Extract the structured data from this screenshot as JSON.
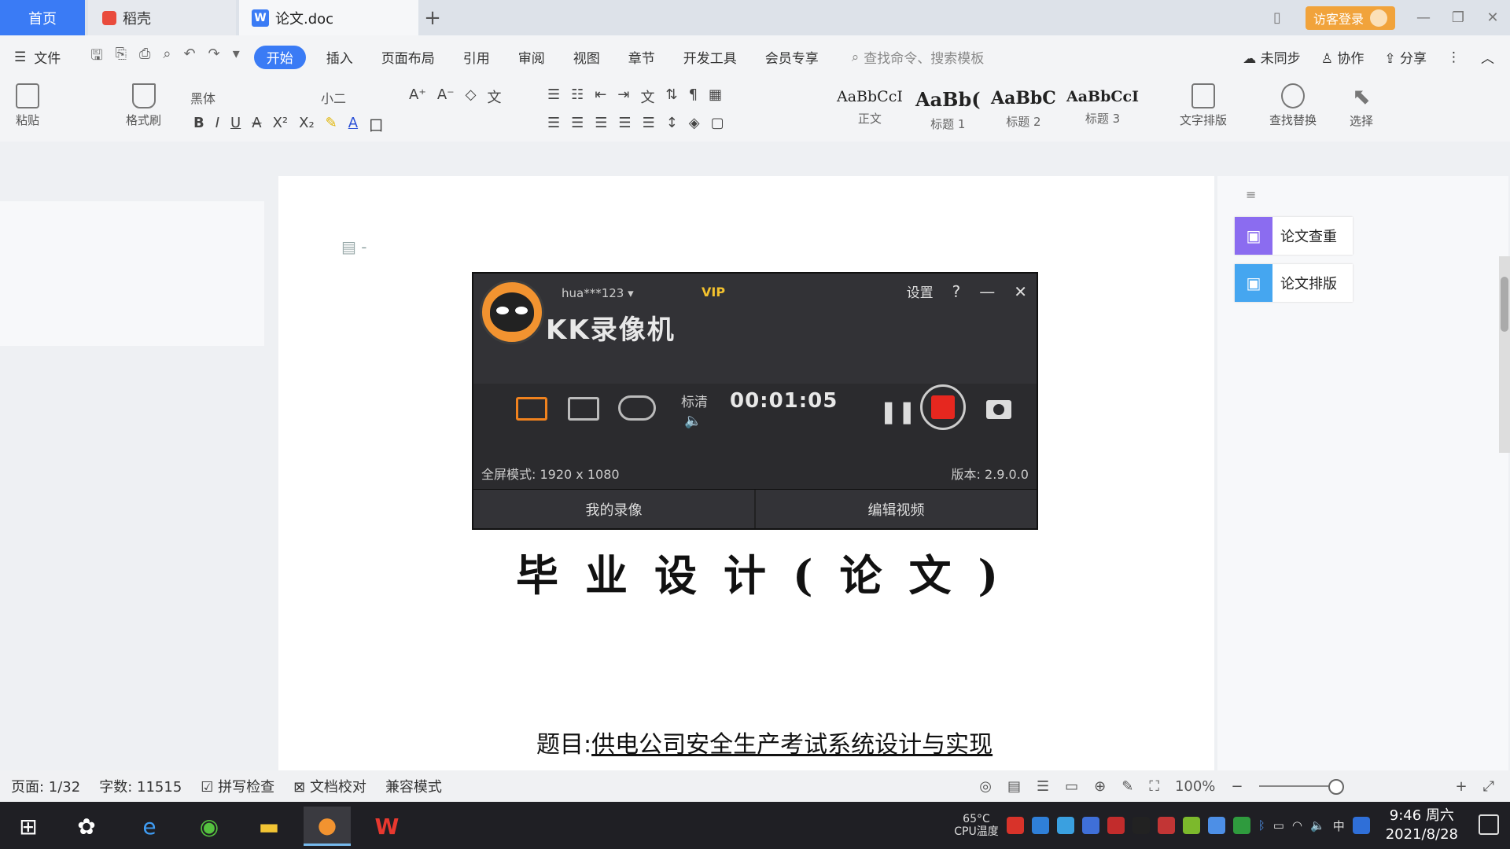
{
  "tabs": {
    "home": "首页",
    "daoke": "稻壳",
    "doc": "论文.doc",
    "add": "+"
  },
  "account": {
    "login": "访客登录"
  },
  "menu": {
    "file": "文件",
    "items": [
      "开始",
      "插入",
      "页面布局",
      "引用",
      "审阅",
      "视图",
      "章节",
      "开发工具",
      "会员专享"
    ],
    "search_placeholder": "查找命令、搜索模板",
    "sync": "未同步",
    "collab": "协作",
    "share": "分享"
  },
  "ribbon": {
    "paste": "粘贴",
    "format_painter": "格式刷",
    "font": "黑体",
    "size": "小二",
    "styles": [
      {
        "sample": "AaBbCcI",
        "name": "正文"
      },
      {
        "sample": "AaBb(",
        "name": "标题 1"
      },
      {
        "sample": "AaBbC",
        "name": "标题 2"
      },
      {
        "sample": "AaBbCcI",
        "name": "标题 3"
      }
    ],
    "text_layout": "文字排版",
    "find_replace": "查找替换",
    "select": "选择"
  },
  "side_panel": {
    "items": [
      "论文查重",
      "论文排版"
    ]
  },
  "document": {
    "title": "毕业设计(论文)",
    "subject_label": "题目:",
    "subject_value": "供电公司安全生产考试系统设计与实现"
  },
  "recorder": {
    "user": "hua***123",
    "vip": "VIP",
    "name": "KK录像机",
    "settings": "设置",
    "help": "?",
    "minimize": "—",
    "close": "✕",
    "quality": "标清",
    "time": "00:01:05",
    "mode": "全屏模式: 1920 x 1080",
    "version": "版本: 2.9.0.0",
    "my_recordings": "我的录像",
    "edit_video": "编辑视频"
  },
  "status": {
    "page": "页面: 1/32",
    "words": "字数: 11515",
    "spell": "拼写检查",
    "proof": "文档校对",
    "compat": "兼容模式",
    "zoom": "100%"
  },
  "taskbar": {
    "cpu_temp": "65°C",
    "cpu_label": "CPU温度",
    "ime": "中",
    "time": "9:46 周六",
    "date": "2021/8/28"
  }
}
